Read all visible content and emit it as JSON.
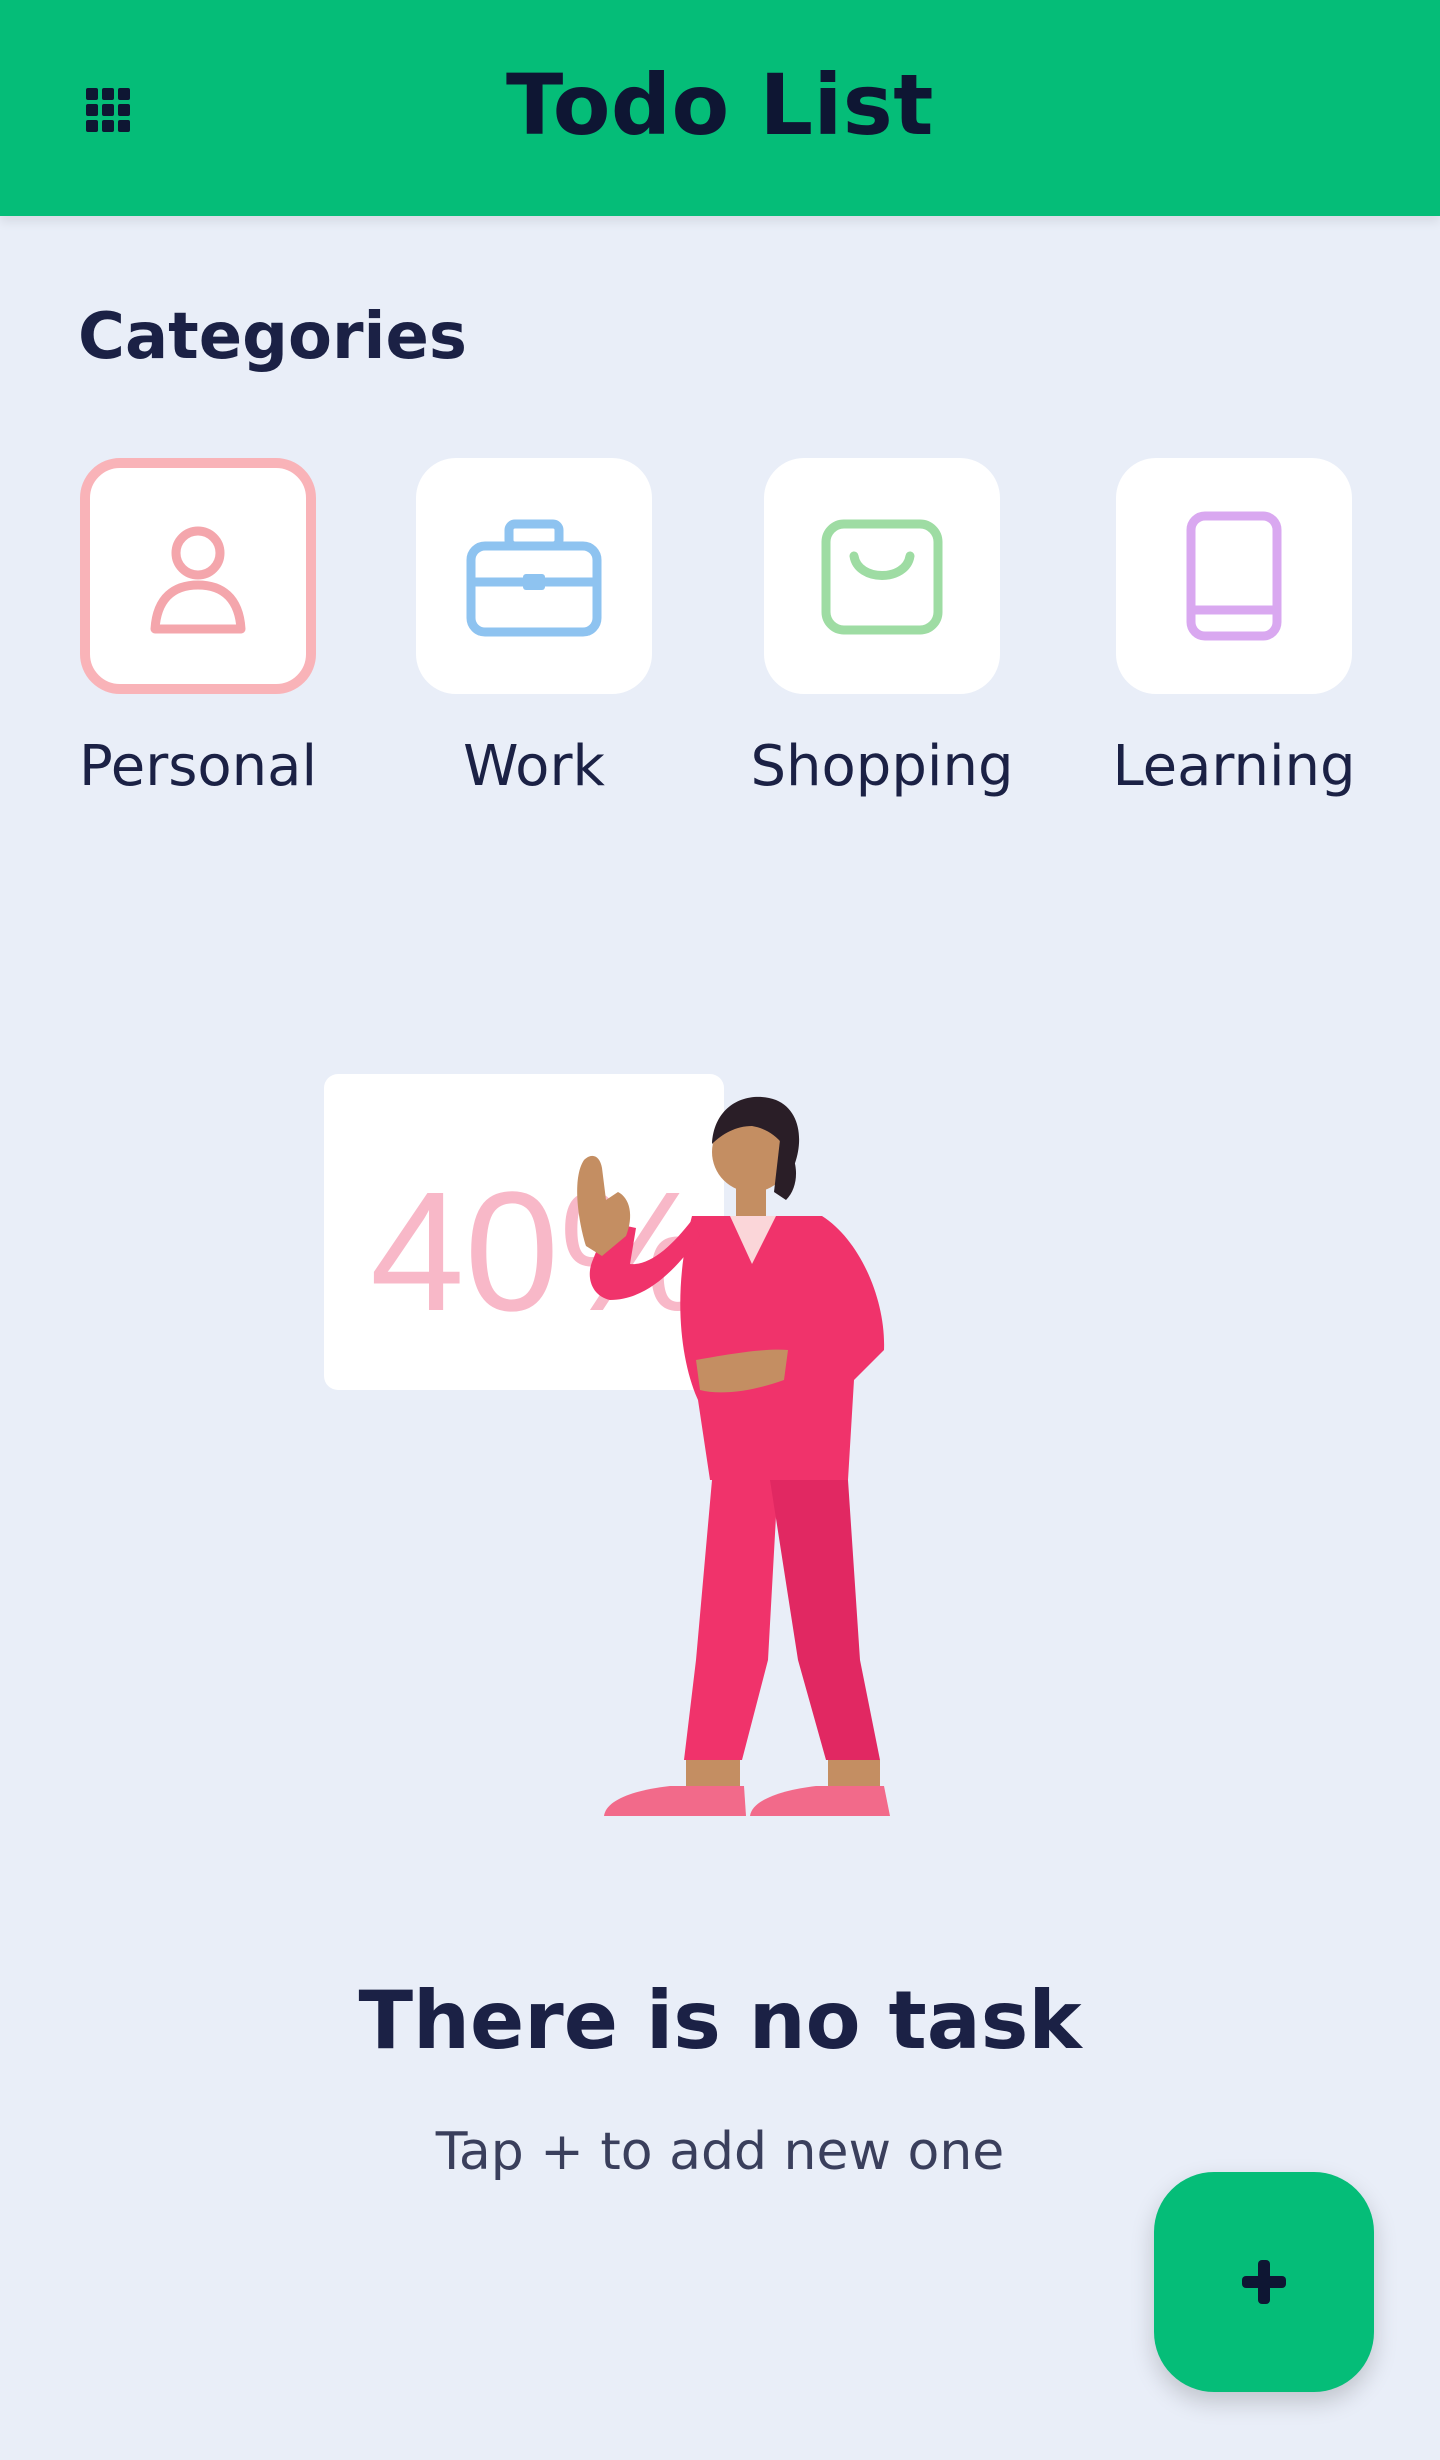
{
  "app_bar": {
    "title": "Todo List",
    "menu_icon": "grid-icon",
    "background_color": "#05BD78"
  },
  "categories": {
    "heading": "Categories",
    "selected": "Personal",
    "items": [
      {
        "label": "Personal",
        "icon": "person-icon",
        "color": "#F4A6AC"
      },
      {
        "label": "Work",
        "icon": "briefcase-icon",
        "color": "#8EC3F0"
      },
      {
        "label": "Shopping",
        "icon": "shopping-bag-icon",
        "color": "#9EDCA3"
      },
      {
        "label": "Learning",
        "icon": "tablet-icon",
        "color": "#D9A8F0"
      }
    ]
  },
  "illustration": {
    "board_text": "40%",
    "figure_color": "#F0336B"
  },
  "empty_state": {
    "title": "There is no task",
    "subtitle": "Tap + to add new one"
  },
  "fab": {
    "icon": "plus-icon",
    "color": "#05BD78"
  }
}
